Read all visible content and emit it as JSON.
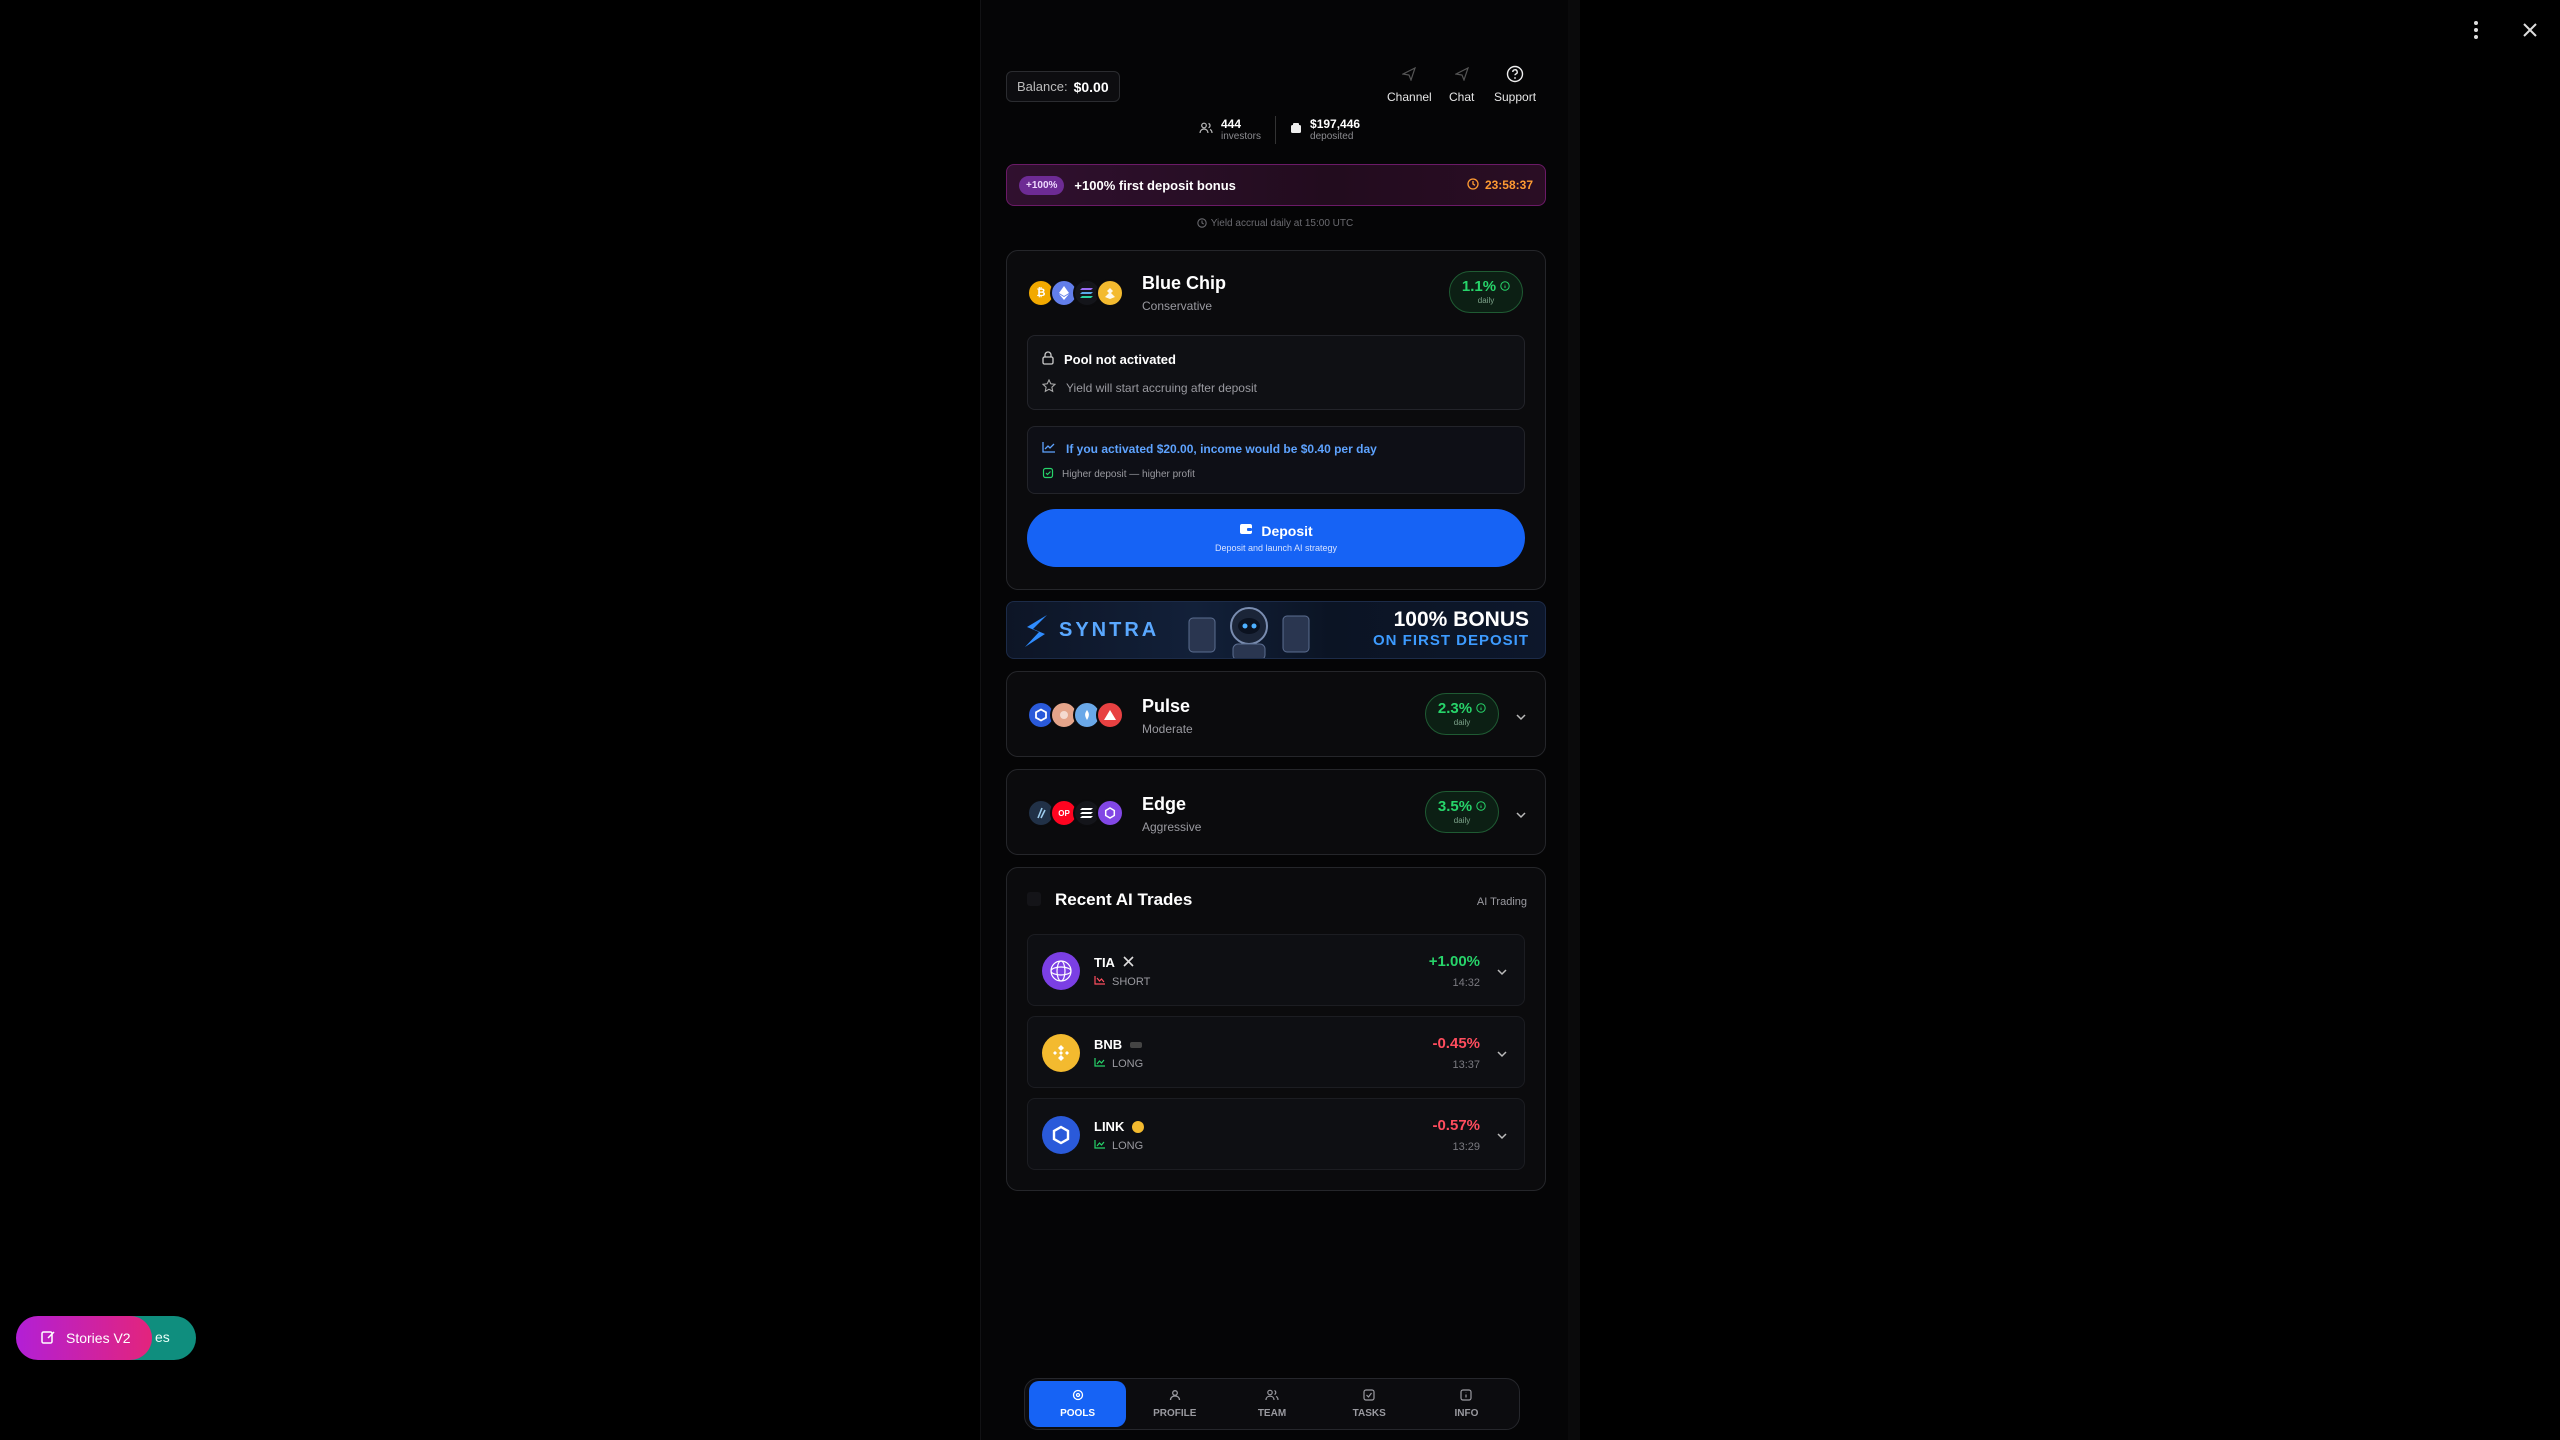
{
  "overlay": {
    "menu_icon": "more-vertical-icon",
    "close_icon": "close-icon"
  },
  "stories": {
    "front_label": "Stories V2",
    "back_label": "es"
  },
  "header": {
    "balance_label": "Balance:",
    "balance_value": "$0.00",
    "nav": [
      {
        "label": "Channel",
        "icon": "send-icon"
      },
      {
        "label": "Chat",
        "icon": "send-icon"
      },
      {
        "label": "Support",
        "icon": "help-circle-icon"
      }
    ],
    "investors_value": "444",
    "investors_label": "investors",
    "deposited_value": "$197,446",
    "deposited_label": "deposited"
  },
  "bonus_bar": {
    "chip": "+100%",
    "text": "+100% first deposit bonus",
    "timer": "23:58:37"
  },
  "accrual_note": "Yield accrual daily at 15:00 UTC",
  "pools": [
    {
      "name": "Blue Chip",
      "risk": "Conservative",
      "rate": "1.1%",
      "rate_unit": "daily",
      "status_title": "Pool not activated",
      "status_sub": "Yield will start accruing after deposit",
      "projection": "If you activated $20.00, income would be $0.40 per day",
      "projection_sub": "Higher deposit — higher profit",
      "deposit_label": "Deposit",
      "deposit_sub": "Deposit and launch AI strategy"
    },
    {
      "name": "Pulse",
      "risk": "Moderate",
      "rate": "2.3%",
      "rate_unit": "daily"
    },
    {
      "name": "Edge",
      "risk": "Aggressive",
      "rate": "3.5%",
      "rate_unit": "daily"
    }
  ],
  "promo_banner": {
    "brand": "SYNTRA",
    "headline": "100% BONUS",
    "subline": "ON FIRST DEPOSIT"
  },
  "recent_trades": {
    "title": "Recent AI Trades",
    "tag": "AI Trading",
    "items": [
      {
        "symbol": "TIA",
        "side": "SHORT",
        "pnl": "+1.00%",
        "time": "14:32"
      },
      {
        "symbol": "BNB",
        "side": "LONG",
        "pnl": "-0.45%",
        "time": "13:37"
      },
      {
        "symbol": "LINK",
        "side": "LONG",
        "pnl": "-0.57%",
        "time": "13:29"
      }
    ]
  },
  "bottom_nav": [
    {
      "label": "POOLS",
      "active": true
    },
    {
      "label": "PROFILE",
      "active": false
    },
    {
      "label": "TEAM",
      "active": false
    },
    {
      "label": "TASKS",
      "active": false
    },
    {
      "label": "INFO",
      "active": false
    }
  ],
  "colors": {
    "accent": "#1663f5",
    "positive": "#27d46a",
    "negative": "#ff4d5e",
    "timer": "#ff9b32"
  }
}
